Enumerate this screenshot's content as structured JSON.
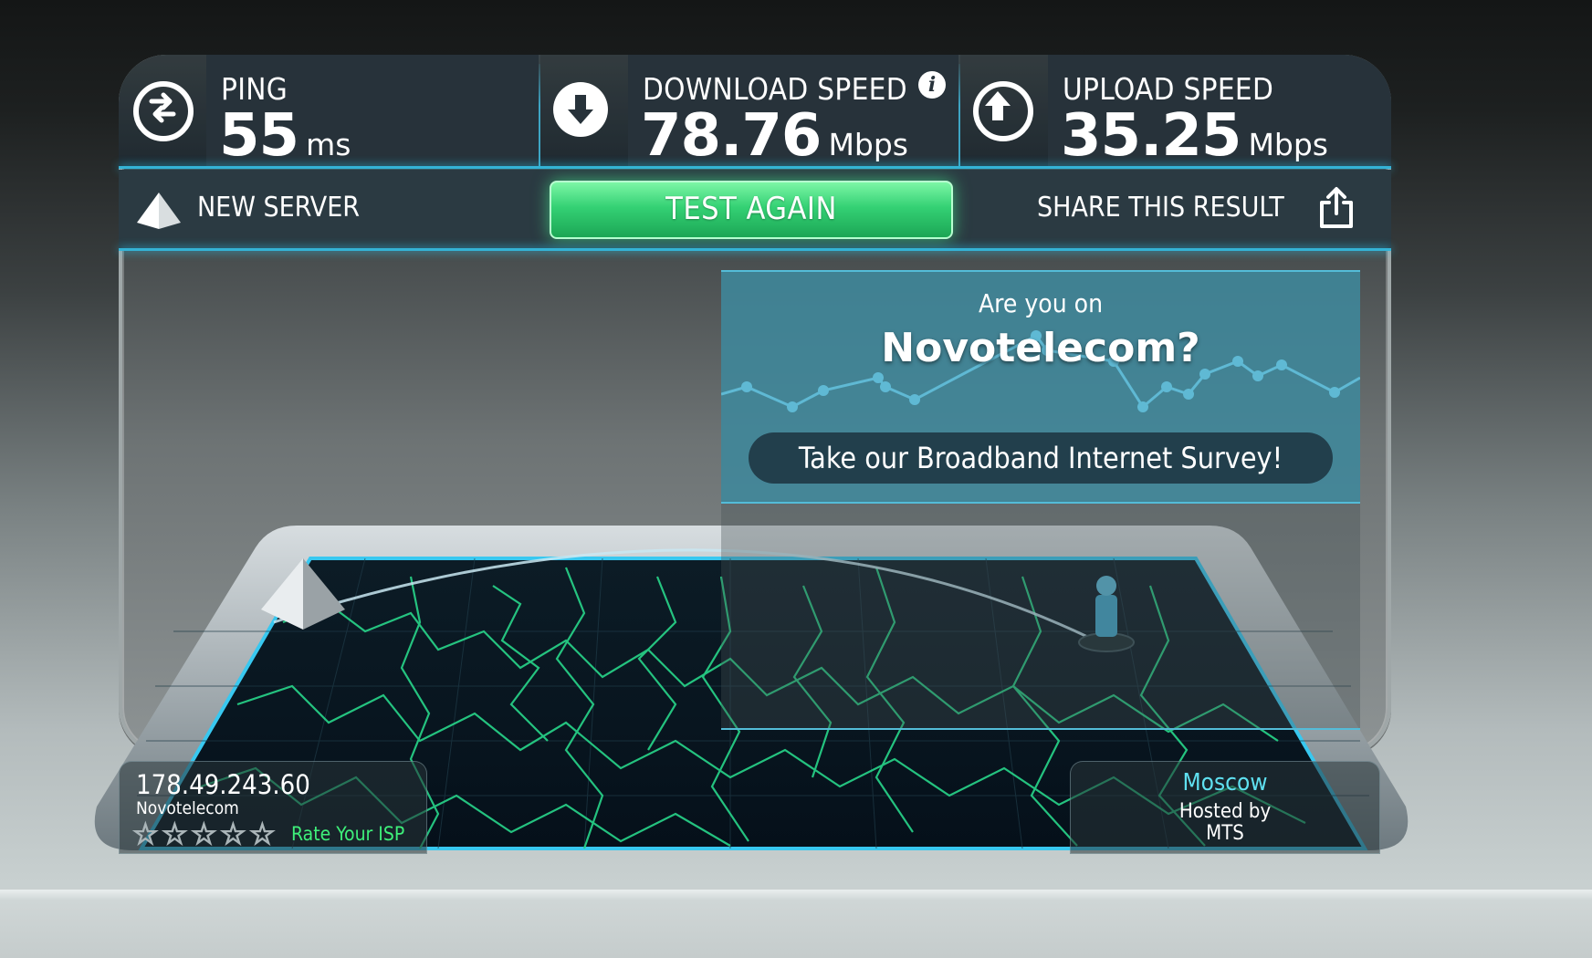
{
  "ping": {
    "label": "PING",
    "value": "55",
    "unit": "ms"
  },
  "download": {
    "label": "DOWNLOAD SPEED",
    "value": "78.76",
    "unit": "Mbps",
    "info_icon": "info-icon"
  },
  "upload": {
    "label": "UPLOAD SPEED",
    "value": "35.25",
    "unit": "Mbps"
  },
  "actions": {
    "new_server": "NEW SERVER",
    "test_again": "TEST AGAIN",
    "share": "SHARE THIS RESULT"
  },
  "survey": {
    "question": "Are you on",
    "isp_name": "Novotelecom?",
    "button": "Take our Broadband Internet Survey!"
  },
  "client": {
    "ip": "178.49.243.60",
    "isp": "Novotelecom",
    "rate_label": "Rate Your ISP",
    "stars": [
      "☆",
      "☆",
      "☆",
      "☆",
      "☆"
    ]
  },
  "server": {
    "city": "Moscow",
    "hosted_by": "Hosted by",
    "host": "MTS"
  },
  "colors": {
    "accent": "#34b3d6",
    "button_green": "#34d174",
    "map_lines": "#2fe08a",
    "city": "#5fe0f0",
    "rate": "#3ef07a"
  }
}
